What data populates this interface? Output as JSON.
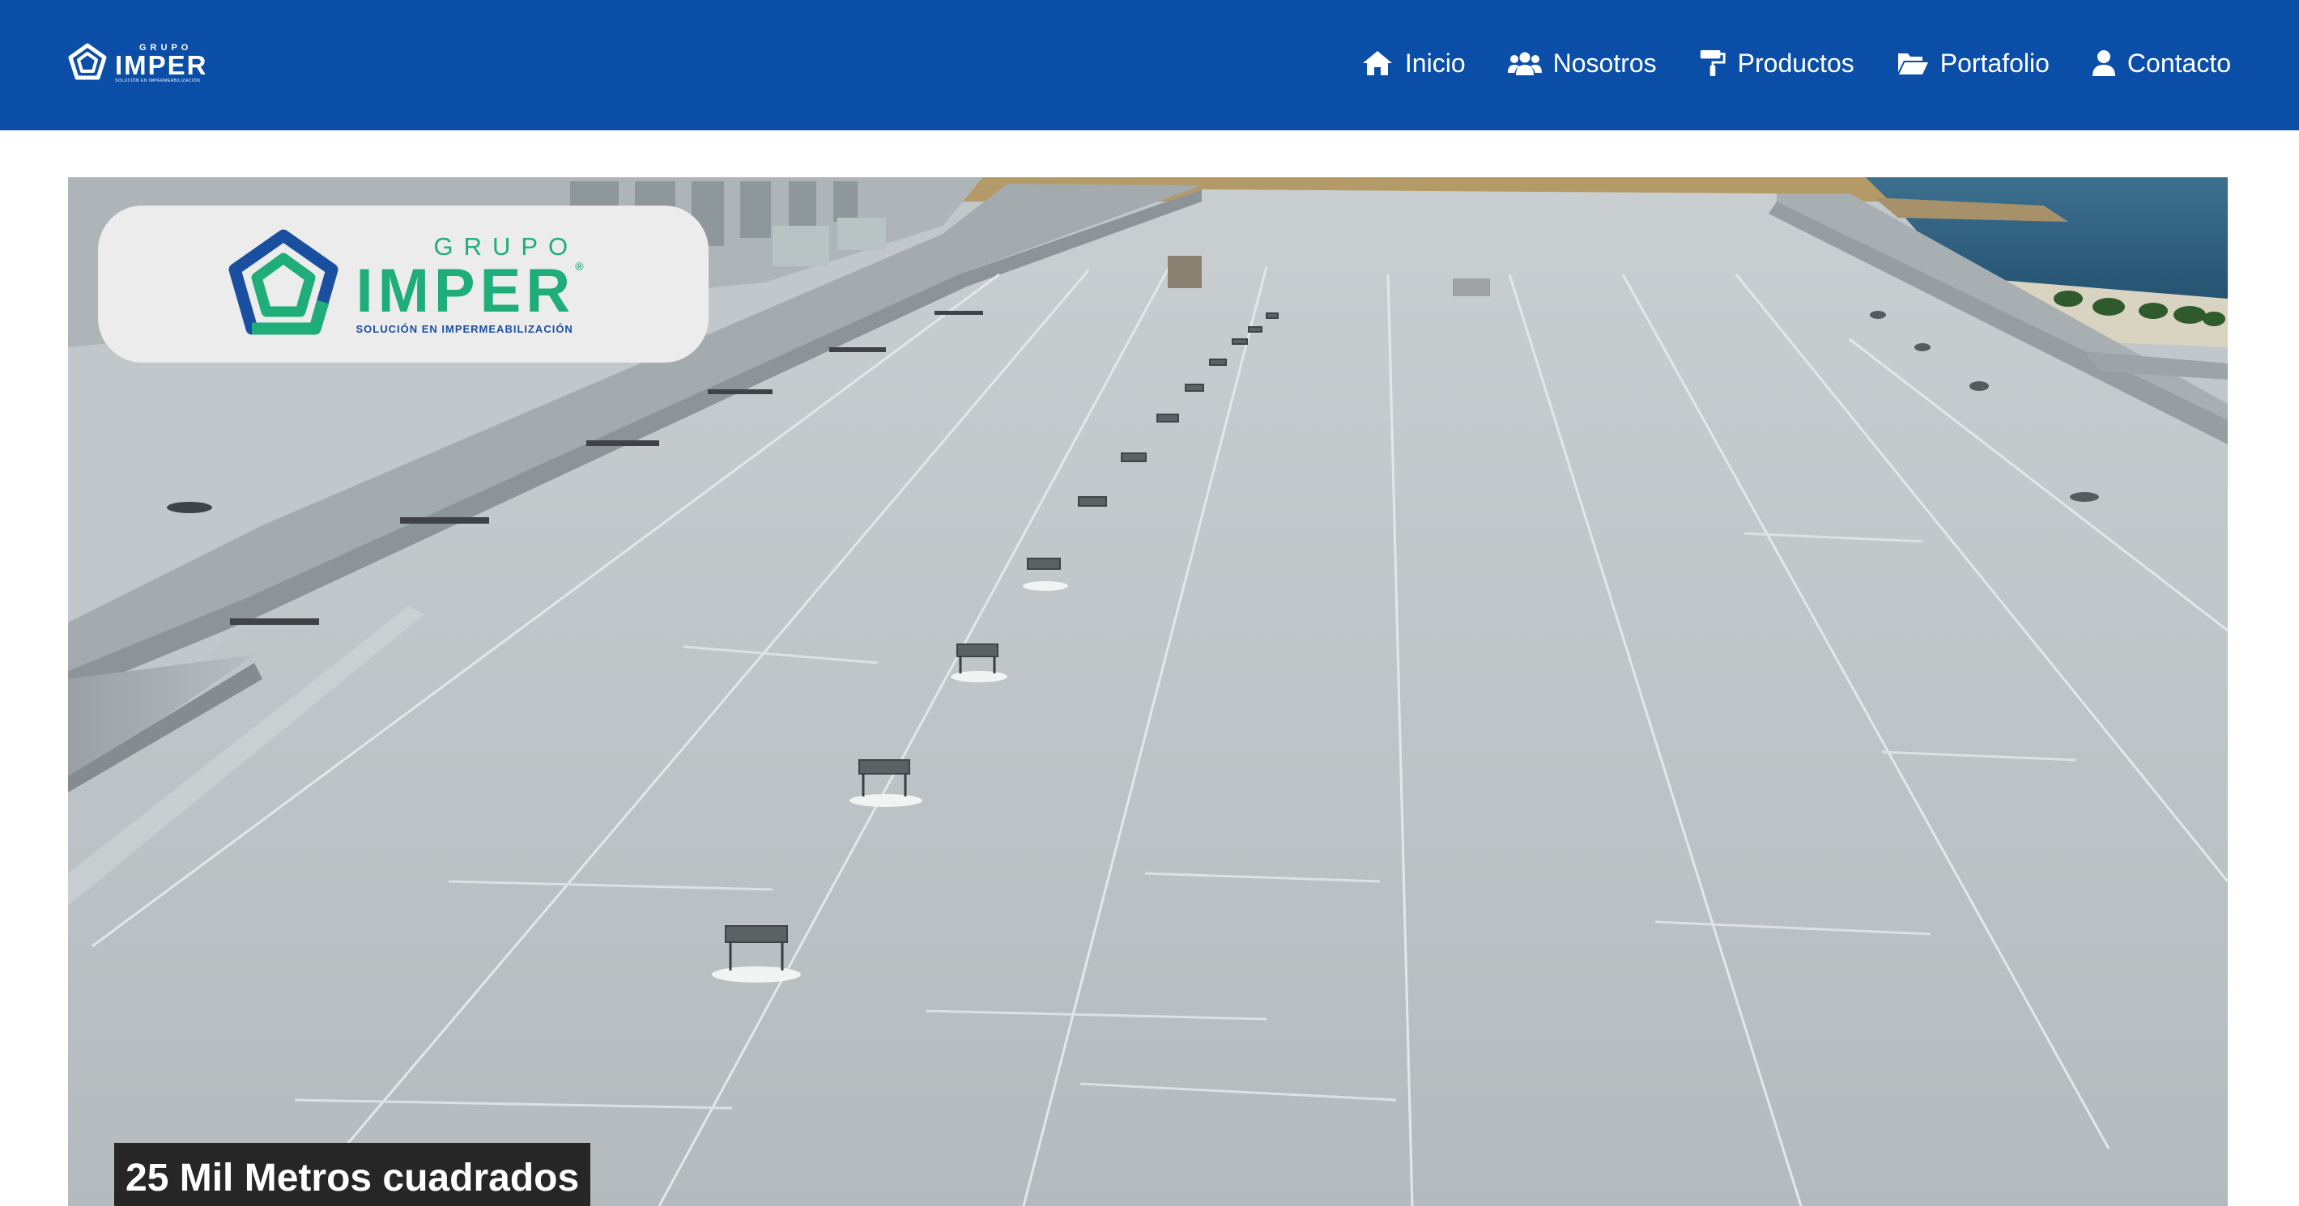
{
  "colors": {
    "header_bg": "#0b4ea8",
    "brand_green": "#1fae7a",
    "brand_blue": "#1a4fa0",
    "caption_bg": "#262626"
  },
  "header": {
    "logo": {
      "grupo": "GRUPO",
      "name": "IMPER",
      "tagline": "SOLUCIÓN EN IMPERMEABILIZACIÓN"
    },
    "nav": [
      {
        "label": "Inicio",
        "icon": "home-icon"
      },
      {
        "label": "Nosotros",
        "icon": "users-icon"
      },
      {
        "label": "Productos",
        "icon": "paint-roller-icon"
      },
      {
        "label": "Portafolio",
        "icon": "folder-open-icon"
      },
      {
        "label": "Contacto",
        "icon": "user-icon"
      }
    ]
  },
  "hero": {
    "logo": {
      "grupo": "GRUPO",
      "name": "IMPER",
      "registered": "®",
      "tagline": "SOLUCIÓN EN IMPERMEABILIZACIÓN"
    },
    "caption": "25 Mil Metros cuadrados"
  }
}
